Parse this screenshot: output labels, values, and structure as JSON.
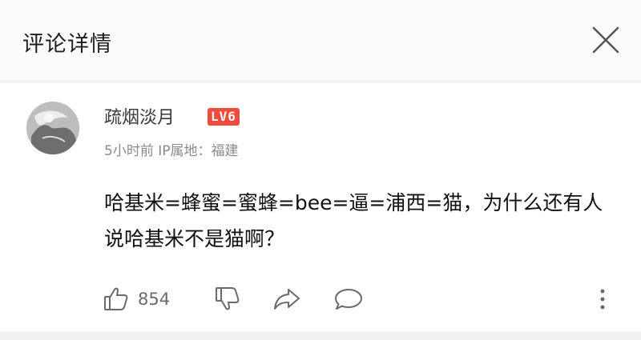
{
  "header": {
    "title": "评论详情",
    "close_icon": "close-icon"
  },
  "comment": {
    "author": {
      "name": "疏烟淡月",
      "level_badge": "LV6",
      "avatar_icon": "avatar-icon"
    },
    "meta": "5小时前 IP属地：福建",
    "text": "哈基米=蜂蜜=蜜蜂=bee=逼=浦西=猫，为什么还有人说哈基米不是猫啊？",
    "actions": {
      "like_icon": "thumbs-up-icon",
      "like_count": "854",
      "dislike_icon": "thumbs-down-icon",
      "share_icon": "share-icon",
      "reply_icon": "comment-bubble-icon",
      "more_icon": "more-vertical-icon"
    }
  },
  "colors": {
    "level_badge": "#ef4b3e",
    "meta_text": "#8a8a8a",
    "icon": "#6a6a6a"
  }
}
